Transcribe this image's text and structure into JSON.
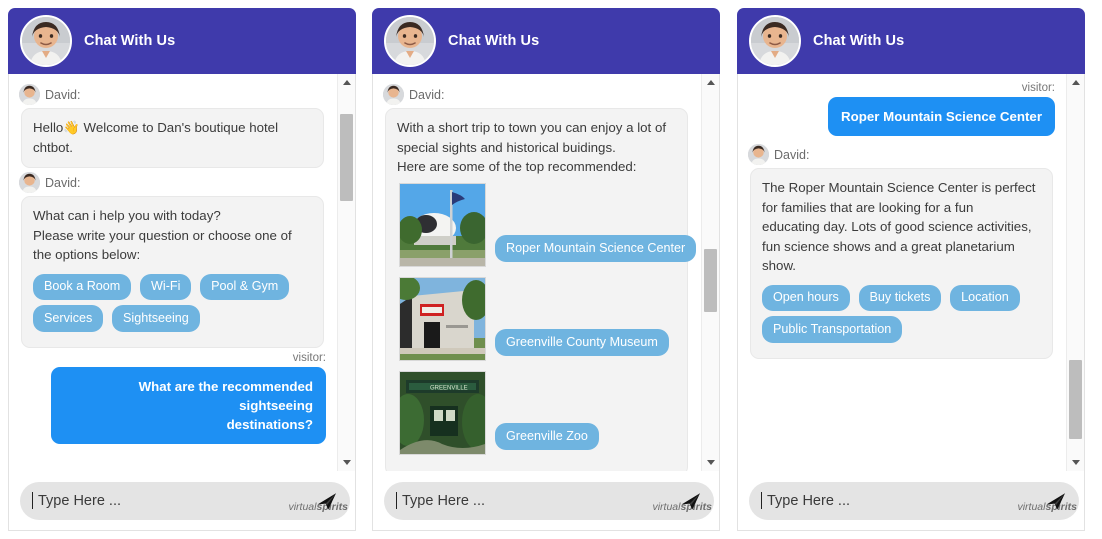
{
  "widgets": [
    {
      "id": "panel-1",
      "header": {
        "title": "Chat With Us",
        "avatar_icon": "agent-avatar-icon",
        "bg": "#3f3aab"
      },
      "scrollbar": {
        "thumb_top_pct": 6,
        "thumb_height_pct": 24,
        "up_icon": "chevron-up-icon",
        "down_icon": "chevron-down-icon"
      },
      "messages": [
        {
          "kind": "bot",
          "sender": "David:",
          "lines": [
            "Hello👋 Welcome to Dan's boutique hotel",
            "chtbot."
          ],
          "chips": []
        },
        {
          "kind": "bot",
          "sender": "David:",
          "lines": [
            "What can i help you with today?",
            "Please write your question or choose one of",
            "the options below:"
          ],
          "chips": [
            "Book a Room",
            "Wi-Fi",
            "Pool & Gym",
            "Services",
            "Sightseeing"
          ]
        },
        {
          "kind": "visitor",
          "label": "visitor:",
          "lines": [
            "What are the recommended sightseeing",
            "destinations?"
          ]
        }
      ],
      "composer": {
        "placeholder": "Type Here ...",
        "send_icon": "send-paper-plane-icon"
      },
      "brand": {
        "light": "virtual",
        "bold": "spirits"
      }
    },
    {
      "id": "panel-2",
      "header": {
        "title": "Chat With Us",
        "avatar_icon": "agent-avatar-icon",
        "bg": "#3f3aab"
      },
      "scrollbar": {
        "thumb_top_pct": 44,
        "thumb_height_pct": 16,
        "up_icon": "chevron-up-icon",
        "down_icon": "chevron-down-icon"
      },
      "messages": [
        {
          "kind": "bot",
          "sender": "David:",
          "lines": [
            "With a short trip to town you can enjoy a lot of",
            "special sights and historical buidings.",
            "Here are some of the top recommended:"
          ],
          "gallery": [
            {
              "image": "observatory-photo",
              "chip": "Roper Mountain Science Center"
            },
            {
              "image": "museum-building-photo",
              "chip": "Greenville County Museum"
            },
            {
              "image": "zoo-entrance-photo",
              "chip": "Greenville Zoo"
            }
          ]
        }
      ],
      "composer": {
        "placeholder": "Type Here ...",
        "send_icon": "send-paper-plane-icon"
      },
      "brand": {
        "light": "virtual",
        "bold": "spirits"
      }
    },
    {
      "id": "panel-3",
      "header": {
        "title": "Chat With Us",
        "avatar_icon": "agent-avatar-icon",
        "bg": "#3f3aab"
      },
      "scrollbar": {
        "thumb_top_pct": 74,
        "thumb_height_pct": 20,
        "up_icon": "chevron-up-icon",
        "down_icon": "chevron-down-icon"
      },
      "messages": [
        {
          "kind": "visitor",
          "label": "visitor:",
          "lines": [
            "Roper Mountain Science Center"
          ]
        },
        {
          "kind": "bot",
          "sender": "David:",
          "lines": [
            "The Roper Mountain Science Center is perfect",
            "for families that are looking for a fun",
            "educating day. Lots of good science activities,",
            "fun science shows and a great planetarium",
            "show."
          ],
          "chips": [
            "Open hours",
            "Buy tickets",
            "Location",
            "Public Transportation"
          ]
        }
      ],
      "composer": {
        "placeholder": "Type Here ...",
        "send_icon": "send-paper-plane-icon"
      },
      "brand": {
        "light": "virtual",
        "bold": "spirits"
      }
    }
  ],
  "colors": {
    "header_purple": "#3f3aab",
    "visitor_blue": "#1e90f3",
    "chip_blue": "#6fb4e0",
    "bot_bubble": "#f3f3f3",
    "input_pill": "#e4e4e4"
  }
}
